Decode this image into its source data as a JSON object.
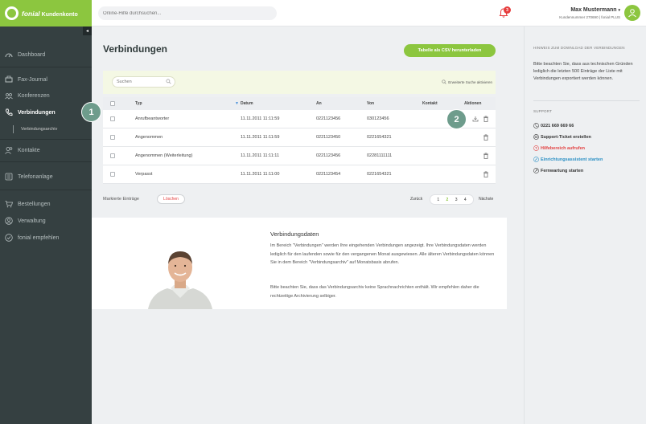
{
  "brand": {
    "name": "fonial",
    "subtitle": "Kundenkonto",
    "color": "#8cc63f"
  },
  "topbar": {
    "search_placeholder": "Online-Hilfe durchsuchen...",
    "notification_count": "3",
    "user_name": "Max Mustermann",
    "user_meta": "Kundennummer 270690 | fonial PLUS"
  },
  "sidebar": {
    "items": [
      {
        "label": "Dashboard",
        "icon": "dashboard-icon"
      },
      {
        "label": "Fax-Journal",
        "icon": "fax-icon"
      },
      {
        "label": "Konferenzen",
        "icon": "conference-icon"
      },
      {
        "label": "Verbindungen",
        "icon": "phone-icon"
      },
      {
        "label": "Kontakte",
        "icon": "contacts-icon"
      },
      {
        "label": "Telefonanlage",
        "icon": "phone-system-icon"
      },
      {
        "label": "Bestellungen",
        "icon": "cart-icon"
      },
      {
        "label": "Verwaltung",
        "icon": "user-icon"
      },
      {
        "label": "fonial empfehlen",
        "icon": "recommend-icon"
      }
    ],
    "sub_item": "Verbindungsarchiv"
  },
  "main": {
    "title": "Verbindungen",
    "csv_button": "Tabelle als CSV herunterladen",
    "table_search_placeholder": "Suchen",
    "advanced_search": "Erweiterte Suche aktivieren",
    "columns": [
      "Typ",
      "Datum",
      "An",
      "Von",
      "Kontakt",
      "Aktionen"
    ],
    "rows": [
      {
        "typ": "Anrufbeantworter",
        "datum": "11.11.2011 11:11:59",
        "an": "0221123456",
        "von": "030123456",
        "kontakt": ""
      },
      {
        "typ": "Angenommen",
        "datum": "11.11.2011 11:11:59",
        "an": "0221123450",
        "von": "0221654321",
        "kontakt": ""
      },
      {
        "typ": "Angenommen (Weiterleitung)",
        "datum": "11.11.2011 11:11:11",
        "an": "0221123456",
        "von": "02281111111",
        "kontakt": ""
      },
      {
        "typ": "Verpasst",
        "datum": "11.11.2011 11:11:00",
        "an": "0221123454",
        "von": "0221654321",
        "kontakt": ""
      }
    ],
    "marked_label": "Markierte Einträge",
    "delete_button": "Löschen",
    "pagination": {
      "back": "Zurück",
      "pages": [
        "1",
        "2",
        "3",
        "4"
      ],
      "current": "2",
      "next": "Nächste"
    }
  },
  "info": {
    "title": "Verbindungsdaten",
    "p1": "Im Bereich \"Verbindungen\" werden Ihre eingehenden Verbindungen angezeigt. Ihre Verbindungsdaten werden lediglich für den laufenden sowie für den vergangenen Monat ausgewiesen. Alle älteren Verbindungsdaten können Sie in dem Bereich \"Verbindungsarchiv\" auf Monatsbasis abrufen.",
    "p2": "Bitte beachten Sie, dass das Verbindungsarchiv keine Sprachnachrichten enthält. Wir empfehlen daher die rechtzeitige Archivierung selbiger."
  },
  "markers": [
    "1",
    "2"
  ],
  "right_panel": {
    "download_heading": "HINWEIS ZUM DOWNLOAD DER VERBINDUNGEN",
    "download_text": "Bitte beachten Sie, dass aus technischen Gründen lediglich die letzten 500 Einträge der Liste mit Verbindungen exportiert werden können.",
    "support_heading": "SUPPORT",
    "support_items": [
      {
        "label": "0221 669 669 66",
        "color": "#333333",
        "icon": "phone-icon"
      },
      {
        "label": "Support-Ticket erstellen",
        "color": "#333333",
        "icon": "ticket-icon"
      },
      {
        "label": "Hilfebereich aufrufen",
        "color": "#e34040",
        "icon": "help-icon"
      },
      {
        "label": "Einrichtungsassistent starten",
        "color": "#2a8fc4",
        "icon": "wizard-icon"
      },
      {
        "label": "Fernwartung starten",
        "color": "#333333",
        "icon": "remote-icon"
      }
    ]
  }
}
